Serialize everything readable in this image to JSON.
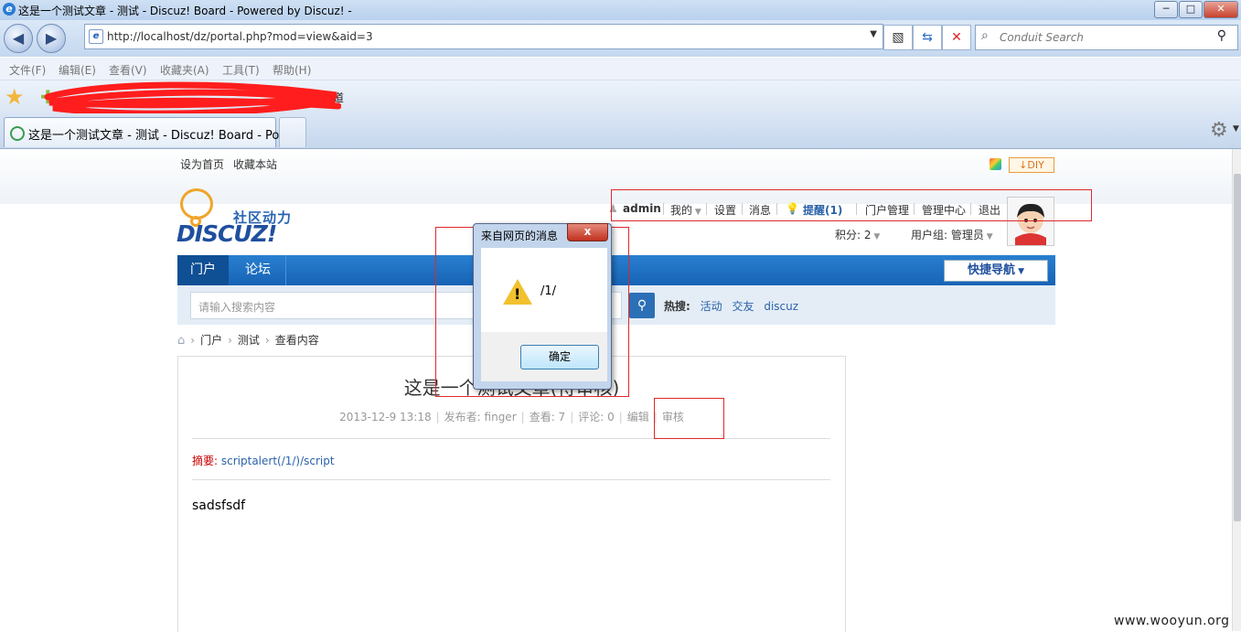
{
  "window": {
    "title": "这是一个测试文章 - 测试 - Discuz! Board - Powered by Discuz! -",
    "controls": {
      "minimize": "─",
      "maximize": "□",
      "close": "✕"
    }
  },
  "browser": {
    "address": "http://localhost/dz/portal.php?mod=view&aid=3",
    "search_placeholder": "Conduit Search",
    "menu": [
      "文件(F)",
      "编辑(E)",
      "查看(V)",
      "收藏夹(A)",
      "工具(T)",
      "帮助(H)"
    ],
    "favorites_item": "我知道",
    "tab_title": "这是一个测试文章 - 测试 - Discuz! Board - Po..."
  },
  "site": {
    "top_links": [
      "设为首页",
      "收藏本站"
    ],
    "diy_label": "DIY",
    "logo": {
      "cn": "社区动力",
      "en": "DISCUZ!"
    },
    "user": {
      "name": "admin",
      "links": [
        "我的",
        "设置",
        "消息",
        "提醒(1)",
        "门户管理",
        "管理中心",
        "退出"
      ],
      "points": "积分: 2",
      "group": "用户组: 管理员"
    },
    "nav": {
      "items": [
        "门户",
        "论坛"
      ],
      "quick_nav": "快捷导航"
    },
    "search": {
      "placeholder": "请输入搜索内容",
      "hot_label": "热搜:",
      "hot_terms": [
        "活动",
        "交友",
        "discuz"
      ]
    },
    "breadcrumb": [
      "门户",
      "测试",
      "查看内容"
    ]
  },
  "article": {
    "title": "这是一个测试文章(待审核)",
    "date": "2013-12-9 13:18",
    "author": "发布者: finger",
    "views": "查看: 7",
    "comments": "评论: 0",
    "edit": "编辑",
    "audit": "审核",
    "summary_label": "摘要:",
    "summary_value": "scriptalert(/1/)/script",
    "body": "sadsfsdf"
  },
  "dialog": {
    "title": "来自网页的消息",
    "close": "x",
    "message": "/1/",
    "ok": "确定"
  },
  "watermark": "www.wooyun.org",
  "colors": {
    "annotation_red": "#e0282a",
    "nav_blue": "#1663b5",
    "link_blue": "#2b62a8"
  }
}
